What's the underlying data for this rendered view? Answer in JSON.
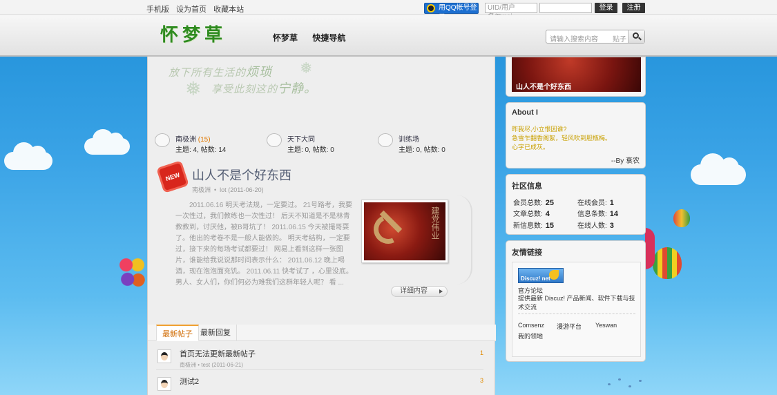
{
  "topbar": {
    "links": [
      "手机版",
      "设为首页",
      "收藏本站"
    ],
    "qq_login": "用QQ帐号登录",
    "uid_placeholder": "UID/用户名/Emai",
    "login": "登录",
    "register": "注册"
  },
  "header": {
    "logo": "怀梦草",
    "nav": [
      "怀梦草",
      "快捷导航"
    ],
    "search_placeholder": "请输入搜索内容",
    "search_scope": "贴子"
  },
  "slogan": {
    "line1a": "放下所有生活的",
    "line1b": "烦琐",
    "line2a": "享受此刻这的",
    "line2b": "宁静。"
  },
  "forums": [
    {
      "name": "南极洲",
      "count": "(15)",
      "stats": "主题: 4, 帖数: 14"
    },
    {
      "name": "天下大同",
      "count": "",
      "stats": "主题: 0, 帖数: 0"
    },
    {
      "name": "训练场",
      "count": "",
      "stats": "主题: 0, 帖数: 0"
    }
  ],
  "featured_post": {
    "badge": "NEW",
    "title": "山人不是个好东西",
    "forum": "南极洲",
    "author": "lot",
    "date": "(2011-06-20)",
    "excerpt": "2011.06.16 明天考法规，一定要过。 21号路考，我要一次性过，我们教练也一次性过！ 后天不知道是不是林青教教到，讨厌他，被B哥坑了！ 2011.06.15 今天被撮哥耍了。他出的考卷不是一般人能做的。 明天考结构，一定要过，接下来的每场考试都要过！ 网易上看到这样一张图片，谁能给我说说那时间表示什么： 2011.06.12 晚上喝酒，现在泡泡面充饥。 2011.06.11 快考试了 ，心里没底。男人、女人们，你们何必为难我们这群年轻人呢？ 看 ...",
    "image_caption": "建党伟业",
    "more": "详细内容"
  },
  "tabs": [
    "最新帖子",
    "最新回复"
  ],
  "threads": [
    {
      "title": "首页无法更新最新帖子",
      "meta": "南极洲 • test (2011-06-21)",
      "count": "1"
    },
    {
      "title": "测试2",
      "meta": "",
      "count": "3"
    }
  ],
  "sidebar": {
    "featured_caption": "山人不是个好东西",
    "about_title": "About I",
    "about_lines": [
      "昨我尽,小立恨因谁?",
      "急雪乍翻香阁絮，轻风吹到胆瓶梅。",
      "心字已成灰。"
    ],
    "about_by": "--By 衰农",
    "community_title": "社区信息",
    "community": [
      {
        "label": "会员总数:",
        "value": "25"
      },
      {
        "label": "在线会员:",
        "value": "1"
      },
      {
        "label": "文章总数:",
        "value": "4"
      },
      {
        "label": "信息条数:",
        "value": "14"
      },
      {
        "label": "新信息数:",
        "value": "15"
      },
      {
        "label": "在线人数:",
        "value": "3"
      }
    ],
    "links_title": "友情链接",
    "logo_text": "Discuz! net",
    "link_name": "官方论坛",
    "link_desc": "提供最新 Discuz! 产品新闻、软件下载与技术交流",
    "text_links": [
      "Comsenz",
      "漫游平台",
      "Yeswan"
    ],
    "text_link_last": "我的领地"
  },
  "colors": {
    "sky_top": "#1e8fd8",
    "sky_bottom": "#8fd6f8",
    "logo_green": "#2e8b1f",
    "accent_orange": "#e07800",
    "qq_blue": "#1d6fd0"
  }
}
